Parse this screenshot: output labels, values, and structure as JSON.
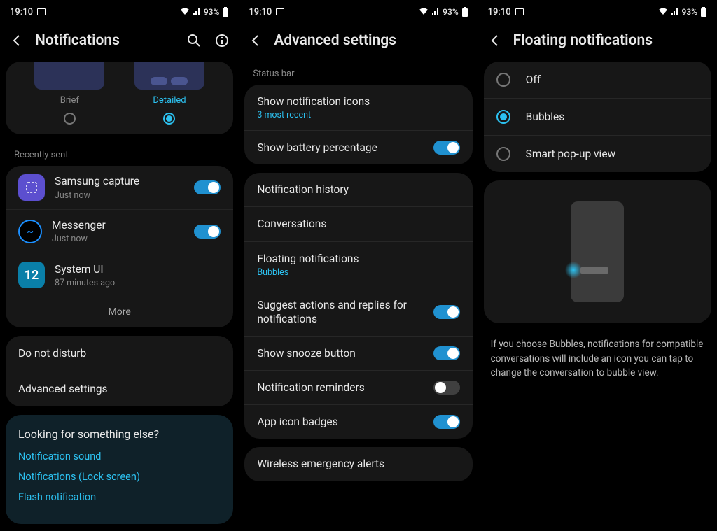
{
  "status": {
    "time": "19:10",
    "battery": "93%"
  },
  "screen1": {
    "title": "Notifications",
    "style_brief": "Brief",
    "style_detailed": "Detailed",
    "recently_sent_label": "Recently sent",
    "apps": [
      {
        "name": "Samsung capture",
        "time": "Just now"
      },
      {
        "name": "Messenger",
        "time": "Just now"
      },
      {
        "name": "System UI",
        "time": "87 minutes ago"
      }
    ],
    "more": "More",
    "dnd": "Do not disturb",
    "advanced": "Advanced settings",
    "else_title": "Looking for something else?",
    "else_links": [
      "Notification sound",
      "Notifications (Lock screen)",
      "Flash notification"
    ]
  },
  "screen2": {
    "title": "Advanced settings",
    "status_bar_label": "Status bar",
    "show_icons": "Show notification icons",
    "show_icons_sub": "3 most recent",
    "show_battery": "Show battery percentage",
    "history": "Notification history",
    "conversations": "Conversations",
    "floating": "Floating notifications",
    "floating_sub": "Bubbles",
    "suggest": "Suggest actions and replies for notifications",
    "snooze": "Show snooze button",
    "reminders": "Notification reminders",
    "badges": "App icon badges",
    "wireless": "Wireless emergency alerts"
  },
  "screen3": {
    "title": "Floating notifications",
    "off": "Off",
    "bubbles": "Bubbles",
    "smart": "Smart pop-up view",
    "desc": "If you choose Bubbles, notifications for compatible conversations will include an icon you can tap to change the conversation to bubble view."
  }
}
